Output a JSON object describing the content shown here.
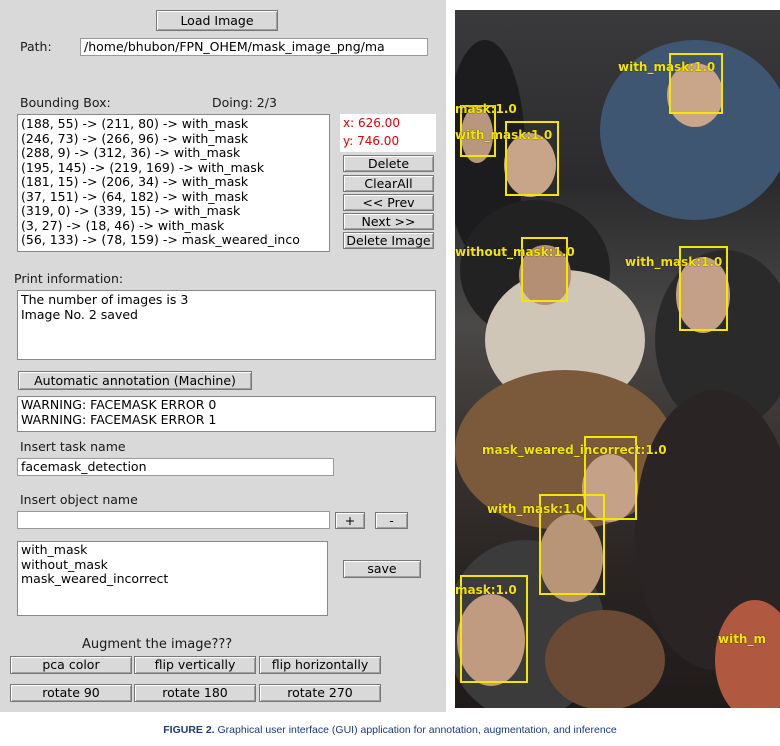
{
  "toolbar": {
    "load_image": "Load Image"
  },
  "path": {
    "label": "Path:",
    "value": "/home/bhubon/FPN_OHEM/mask_image_png/ma"
  },
  "bounding_box": {
    "label": "Bounding Box:",
    "doing": "Doing: 2/3",
    "items": [
      "(188, 55) -> (211, 80) -> with_mask",
      "(246, 73) -> (266, 96) -> with_mask",
      "(288, 9) -> (312, 36) -> with_mask",
      "(195, 145) -> (219, 169) -> with_mask",
      "(181, 15) -> (206, 34) -> with_mask",
      "(37, 151) -> (64, 182) -> with_mask",
      "(319, 0) -> (339, 15) -> with_mask",
      "(3, 27) -> (18, 46) -> with_mask",
      "(56, 133) -> (78, 159) -> mask_weared_inco"
    ]
  },
  "coords": {
    "x": "x: 626.00",
    "y": "y: 746.00"
  },
  "side_buttons": {
    "delete": "Delete",
    "clear_all": "ClearAll",
    "prev": "<< Prev",
    "next": "Next >>",
    "delete_image": "Delete Image"
  },
  "print_info": {
    "label": "Print information:",
    "lines": [
      "The number of images is 3",
      "Image No. 2 saved"
    ]
  },
  "auto_annotation": {
    "button": "Automatic annotation (Machine)",
    "lines": [
      "WARNING: FACEMASK ERROR 0",
      "WARNING: FACEMASK ERROR 1"
    ]
  },
  "task": {
    "label": "Insert task name",
    "value": "facemask_detection"
  },
  "object": {
    "label": "Insert object name",
    "value": "",
    "plus": "+",
    "minus": "-",
    "classes": [
      "with_mask",
      "without_mask",
      "mask_weared_incorrect"
    ],
    "save": "save"
  },
  "augment": {
    "label": "Augment the image???",
    "row1": [
      "pca color",
      "flip vertically",
      "flip horizontally"
    ],
    "row2": [
      "rotate 90",
      "rotate 180",
      "rotate 270"
    ]
  },
  "image_labels": [
    "mask:1.0",
    "with_mask:1.0",
    "with_mask:1.0",
    "without_mask:1.0",
    "with_mask:1.0",
    "mask_weared_incorrect:1.0",
    "with_mask:1.0",
    "mask:1.0",
    "with_m"
  ],
  "colors": {
    "box": "#f5e600",
    "coord_text": "#e00000",
    "panel_bg": "#d9d9d9"
  },
  "caption": {
    "figure": "FIGURE 2.",
    "text": "Graphical user interface (GUI) application for annotation, augmentation, and inference"
  }
}
